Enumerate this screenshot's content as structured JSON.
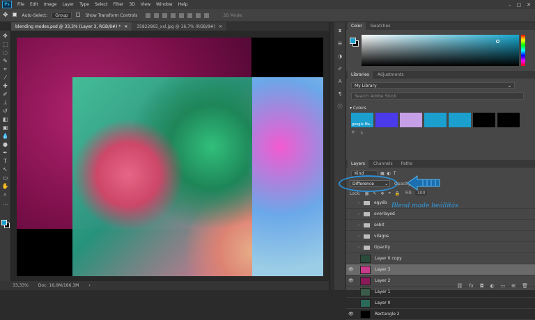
{
  "menubar": {
    "logo": "Ps",
    "items": [
      "File",
      "Edit",
      "Image",
      "Layer",
      "Type",
      "Select",
      "Filter",
      "3D",
      "View",
      "Window",
      "Help"
    ]
  },
  "options": {
    "auto_select_label": "Auto-Select:",
    "auto_select_value": "Group",
    "transform_label": "Show Transform Controls",
    "mode_3d": "3D Mode:"
  },
  "tabs": [
    {
      "label": "blending modes.psd @ 33,3% (Layer 3, RGB/8#) *"
    },
    {
      "label": "35822865_xxl.jpg @ 16,7% (RGB/8#)"
    }
  ],
  "status": {
    "zoom": "33,33%",
    "doc": "Doc: 16,0M/166,3M"
  },
  "color_panel": {
    "tabs": [
      "Color",
      "Swatches"
    ],
    "fg": "#1a9fcf",
    "bg": "#000000"
  },
  "libraries": {
    "tabs": [
      "Libraries",
      "Adjustments"
    ],
    "selected": "My Library",
    "search_placeholder": "Search Adobe Stock",
    "colors_label": "Colors",
    "swatches": [
      {
        "color": "#1a9fcf",
        "name": "google Ma..."
      },
      {
        "color": "#4a3aea",
        "name": ""
      },
      {
        "color": "#c6a0e6",
        "name": ""
      },
      {
        "color": "#1a9fcf",
        "name": ""
      },
      {
        "color": "#1a9fcf",
        "name": ""
      },
      {
        "color": "#000000",
        "name": ""
      },
      {
        "color": "#000000",
        "name": ""
      }
    ]
  },
  "layers_panel": {
    "tabs": [
      "Layers",
      "Channels",
      "Paths"
    ],
    "kind": "Kind",
    "blend_mode": "Difference",
    "opacity_label": "Opacity:",
    "lock_label": "Lock:",
    "fill_label": "Fill:",
    "fill_value": "100",
    "annotation": "Blend mode beállítás",
    "layers": [
      {
        "name": "egyéb",
        "type": "group",
        "visible": false
      },
      {
        "name": "overlayed",
        "type": "group",
        "visible": false
      },
      {
        "name": "sobit",
        "type": "group",
        "visible": false
      },
      {
        "name": "világos",
        "type": "group",
        "visible": false
      },
      {
        "name": "Opacity",
        "type": "group",
        "visible": false
      },
      {
        "name": "Layer 0 copy",
        "type": "layer",
        "visible": false,
        "thumb": "#2a4a3a"
      },
      {
        "name": "Layer 3",
        "type": "layer",
        "visible": true,
        "selected": true,
        "thumb": "#c83a8a"
      },
      {
        "name": "Layer 2",
        "type": "layer",
        "visible": true,
        "thumb": "#8a1a5a"
      },
      {
        "name": "Layer 1",
        "type": "layer",
        "visible": false,
        "thumb": "#3a5a4a"
      },
      {
        "name": "Layer 0",
        "type": "layer",
        "visible": false,
        "thumb": "#2a6a5a"
      },
      {
        "name": "Rectangle 2",
        "type": "layer",
        "visible": true,
        "thumb": "#000000"
      }
    ]
  }
}
